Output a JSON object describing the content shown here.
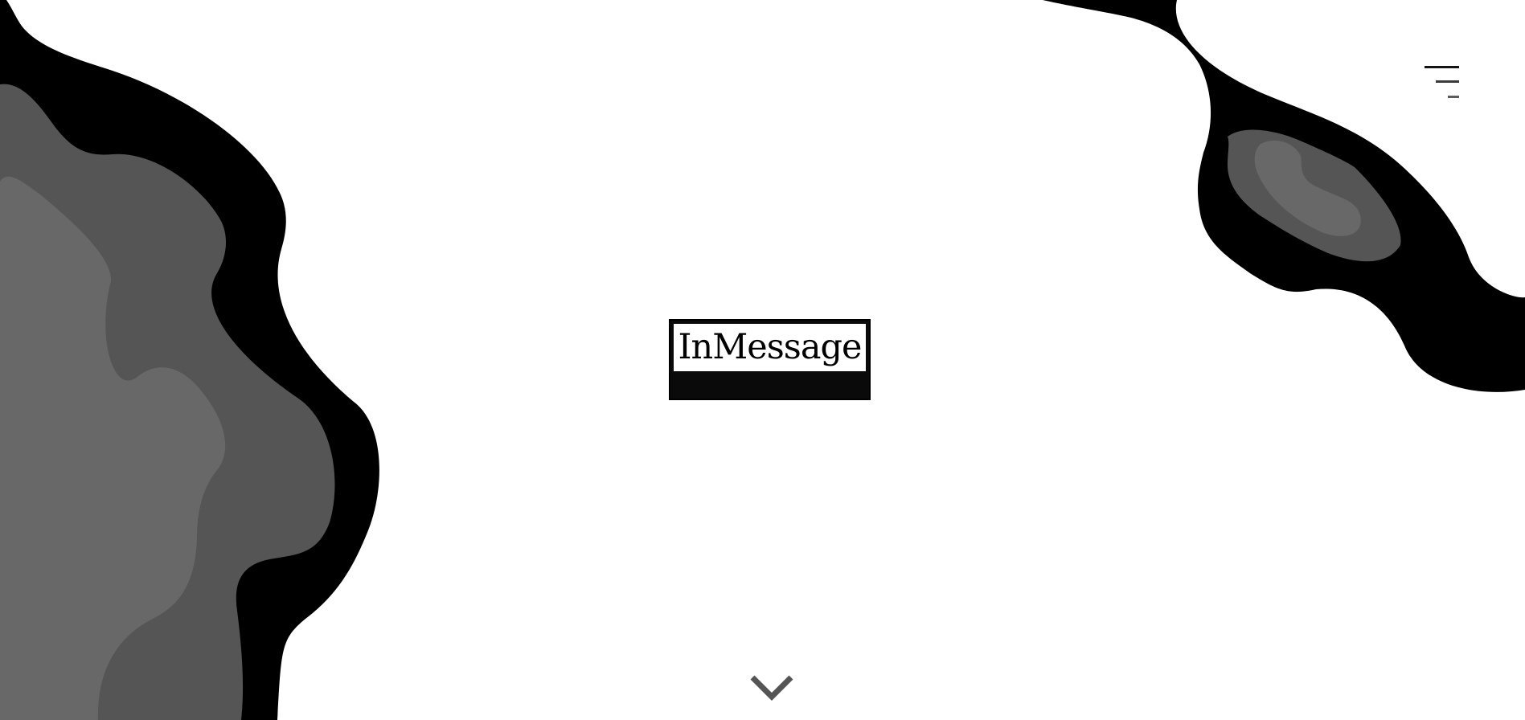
{
  "brand": {
    "name": "InMessage"
  },
  "header": {
    "menu_icon": "hamburger-menu-icon"
  },
  "hero": {
    "scroll_icon": "chevron-down-icon"
  },
  "colors": {
    "background": "#ffffff",
    "blob_black": "#000000",
    "blob_dark_gray": "#555555",
    "blob_mid_gray": "#686868",
    "logo_band": "#0a0a0a",
    "chevron": "#555555"
  }
}
